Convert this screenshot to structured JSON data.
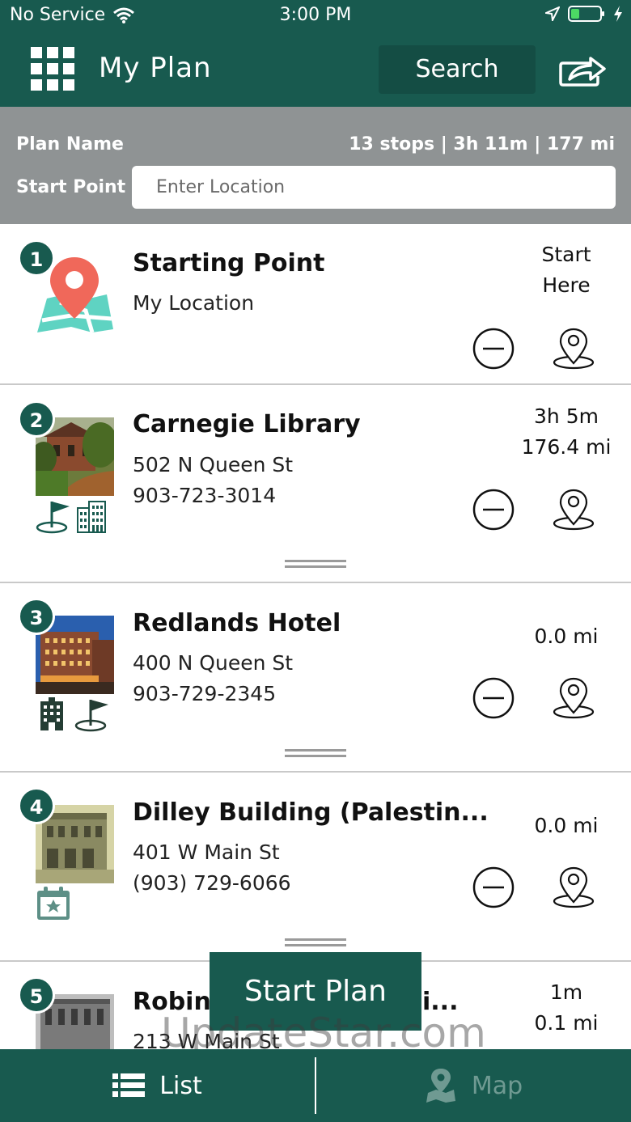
{
  "status_bar": {
    "carrier": "No Service",
    "time": "3:00 PM"
  },
  "header": {
    "title": "My Plan",
    "search_label": "Search"
  },
  "plan_info": {
    "name_label": "Plan Name",
    "stats": "13 stops | 3h 11m | 177 mi",
    "start_label": "Start Point",
    "location_placeholder": "Enter Location"
  },
  "stops": [
    {
      "number": "1",
      "name": "Starting Point",
      "line1": "My Location",
      "line2": "",
      "right1": "Start",
      "right2": "Here"
    },
    {
      "number": "2",
      "name": "Carnegie Library",
      "line1": "502 N Queen St",
      "line2": "903-723-3014",
      "right1": "3h 5m",
      "right2": "176.4 mi"
    },
    {
      "number": "3",
      "name": "Redlands Hotel",
      "line1": "400 N Queen St",
      "line2": "903-729-2345",
      "right1": "0.0 mi",
      "right2": ""
    },
    {
      "number": "4",
      "name": "Dilley Building (Palestin...",
      "line1": "401 W Main St",
      "line2": "(903) 729-6066",
      "right1": "0.0 mi",
      "right2": ""
    },
    {
      "number": "5",
      "name": "Robins",
      "name_tail": "i...",
      "line1": "213 W Main St",
      "right1": "1m",
      "right2": "0.1 mi"
    }
  ],
  "start_plan_label": "Start Plan",
  "watermark": "UpdateStar.com",
  "tabs": {
    "list_label": "List",
    "map_label": "Map"
  },
  "colors": {
    "brand": "#185a4f",
    "plan_bar": "#8f9394"
  }
}
